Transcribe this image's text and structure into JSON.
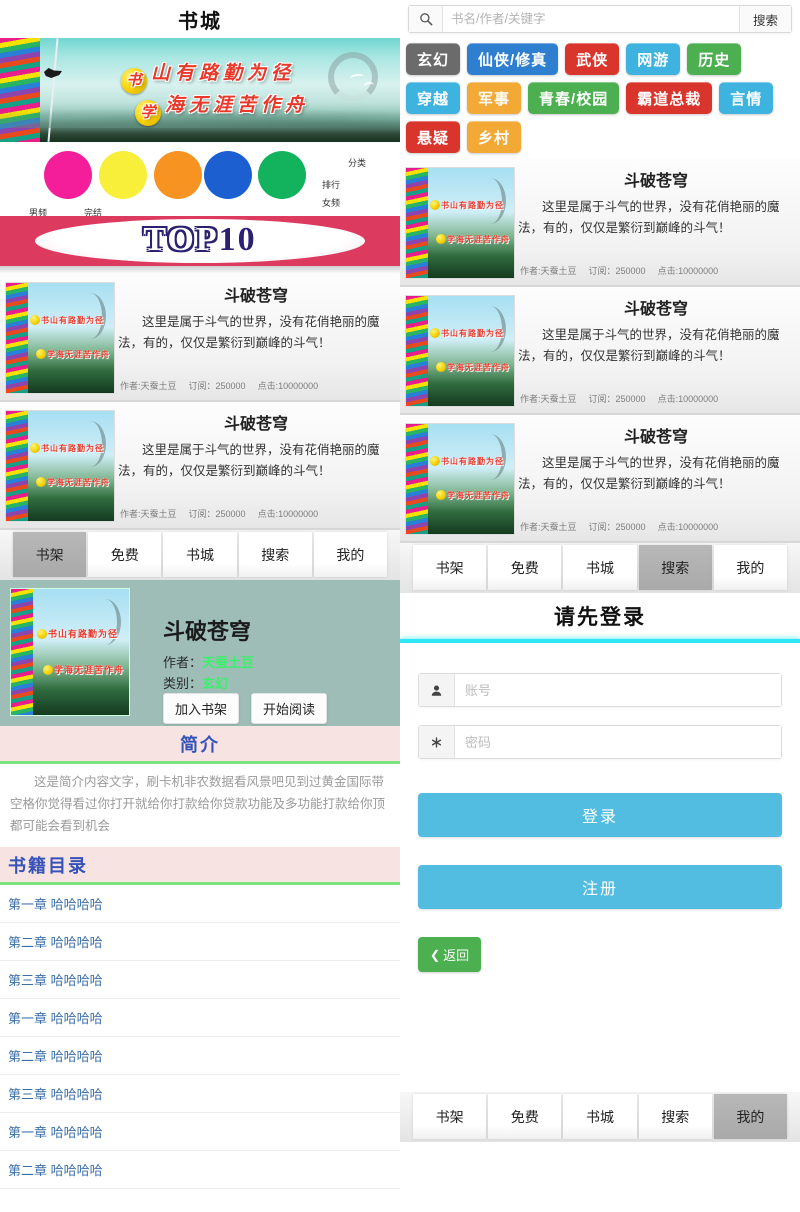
{
  "left": {
    "header_title": "书城",
    "hero": {
      "line1_badge": "书",
      "line1_rest": "山有路勤为径",
      "line2_badge": "学",
      "line2_rest": "海无涯苦作舟"
    },
    "nav": {
      "labels": [
        "男频",
        "完结",
        "分类",
        "排行",
        "女频"
      ],
      "colors": [
        "#f51e9a",
        "#f7ef3a",
        "#f79320",
        "#1b5fd1",
        "#12b35c"
      ]
    },
    "top10": {
      "word": "TOP",
      "number": "10"
    },
    "books": [
      {
        "title": "斗破苍穹",
        "desc": "这里是属于斗气的世界，没有花俏艳丽的魔法，有的，仅仅是繁衍到巅峰的斗气！",
        "author_label": "作者:天蚕土豆",
        "subscribe_label": "订阅：250000",
        "clicks_label": "点击:10000000",
        "cover_line1": "书山有路勤为径",
        "cover_line2": "学海无涯苦作舟"
      },
      {
        "title": "斗破苍穹",
        "desc": "这里是属于斗气的世界，没有花俏艳丽的魔法，有的，仅仅是繁衍到巅峰的斗气！",
        "author_label": "作者:天蚕土豆",
        "subscribe_label": "订阅：250000",
        "clicks_label": "点击:10000000",
        "cover_line1": "书山有路勤为径",
        "cover_line2": "学海无涯苦作舟"
      }
    ],
    "tabs": [
      {
        "label": "书架",
        "active": true
      },
      {
        "label": "免费",
        "active": false
      },
      {
        "label": "书城",
        "active": false
      },
      {
        "label": "搜索",
        "active": false
      },
      {
        "label": "我的",
        "active": false
      }
    ],
    "detail": {
      "title": "斗破苍穹",
      "author_key": "作者：",
      "author_value": "天蚕土豆",
      "category_key": "类别：",
      "category_value": "玄幻",
      "add_shelf_label": "加入书架",
      "start_read_label": "开始阅读",
      "cover_line1": "书山有路勤为径",
      "cover_line2": "学海无涯苦作舟"
    },
    "intro": {
      "heading": "简介",
      "body": "这是简介内容文字，刷卡机非农数据看风景吧见到过黄金国际带空格你觉得看过你打开就给你打款给你贷款功能及多功能打款给你顶都可能会看到机会"
    },
    "catalog": {
      "heading": "书籍目录",
      "chapters": [
        "第一章 哈哈哈哈",
        "第二章 哈哈哈哈",
        "第三章 哈哈哈哈",
        "第一章 哈哈哈哈",
        "第二章 哈哈哈哈",
        "第三章 哈哈哈哈",
        "第一章 哈哈哈哈",
        "第二章 哈哈哈哈"
      ]
    }
  },
  "right": {
    "search": {
      "icon": "search-icon",
      "placeholder": "书名/作者/关键字",
      "value": "",
      "button_label": "搜索"
    },
    "tags": [
      {
        "label": "玄幻",
        "color": "#6b6b6b"
      },
      {
        "label": "仙侠/修真",
        "color": "#2f7fd1"
      },
      {
        "label": "武侠",
        "color": "#d9352c"
      },
      {
        "label": "网游",
        "color": "#3fb3e0"
      },
      {
        "label": "历史",
        "color": "#4caf50"
      },
      {
        "label": "穿越",
        "color": "#3fb3e0"
      },
      {
        "label": "军事",
        "color": "#f3a935"
      },
      {
        "label": "青春/校园",
        "color": "#4caf50"
      },
      {
        "label": "霸道总裁",
        "color": "#d9352c"
      },
      {
        "label": "言情",
        "color": "#3fb3e0"
      },
      {
        "label": "悬疑",
        "color": "#d9352c"
      },
      {
        "label": "乡村",
        "color": "#f3a935"
      }
    ],
    "books": [
      {
        "title": "斗破苍穹",
        "desc": "这里是属于斗气的世界，没有花俏艳丽的魔法，有的，仅仅是繁衍到巅峰的斗气！",
        "author_label": "作者:天蚕土豆",
        "subscribe_label": "订阅：250000",
        "clicks_label": "点击:10000000",
        "cover_line1": "书山有路勤为径",
        "cover_line2": "学海无涯苦作舟"
      },
      {
        "title": "斗破苍穹",
        "desc": "这里是属于斗气的世界，没有花俏艳丽的魔法，有的，仅仅是繁衍到巅峰的斗气！",
        "author_label": "作者:天蚕土豆",
        "subscribe_label": "订阅：250000",
        "clicks_label": "点击:10000000",
        "cover_line1": "书山有路勤为径",
        "cover_line2": "学海无涯苦作舟"
      },
      {
        "title": "斗破苍穹",
        "desc": "这里是属于斗气的世界，没有花俏艳丽的魔法，有的，仅仅是繁衍到巅峰的斗气！",
        "author_label": "作者:天蚕土豆",
        "subscribe_label": "订阅：250000",
        "clicks_label": "点击:10000000",
        "cover_line1": "书山有路勤为径",
        "cover_line2": "学海无涯苦作舟"
      }
    ],
    "tabs_mid": [
      {
        "label": "书架",
        "active": false
      },
      {
        "label": "免费",
        "active": false
      },
      {
        "label": "书城",
        "active": false
      },
      {
        "label": "搜索",
        "active": true
      },
      {
        "label": "我的",
        "active": false
      }
    ],
    "login": {
      "title": "请先登录",
      "account": {
        "icon": "user-icon",
        "placeholder": "账号",
        "value": ""
      },
      "password": {
        "icon": "asterisk-icon",
        "placeholder": "密码",
        "value": ""
      },
      "login_label": "登录",
      "register_label": "注册",
      "back_label": "返回",
      "back_icon": "chevron-left-icon"
    },
    "tabs_bottom": [
      {
        "label": "书架",
        "active": false
      },
      {
        "label": "免费",
        "active": false
      },
      {
        "label": "书城",
        "active": false
      },
      {
        "label": "搜索",
        "active": false
      },
      {
        "label": "我的",
        "active": true
      }
    ]
  },
  "accent": {
    "teal": "#9dbdb6",
    "pink_head": "#f8e3e3",
    "green_rule": "#79e37e",
    "blue_heading": "#3552b8",
    "cyan_rule": "#2fe6f5",
    "btn_blue": "#52bde0",
    "btn_green": "#4caf50",
    "top10_red": "#dd3a60"
  }
}
